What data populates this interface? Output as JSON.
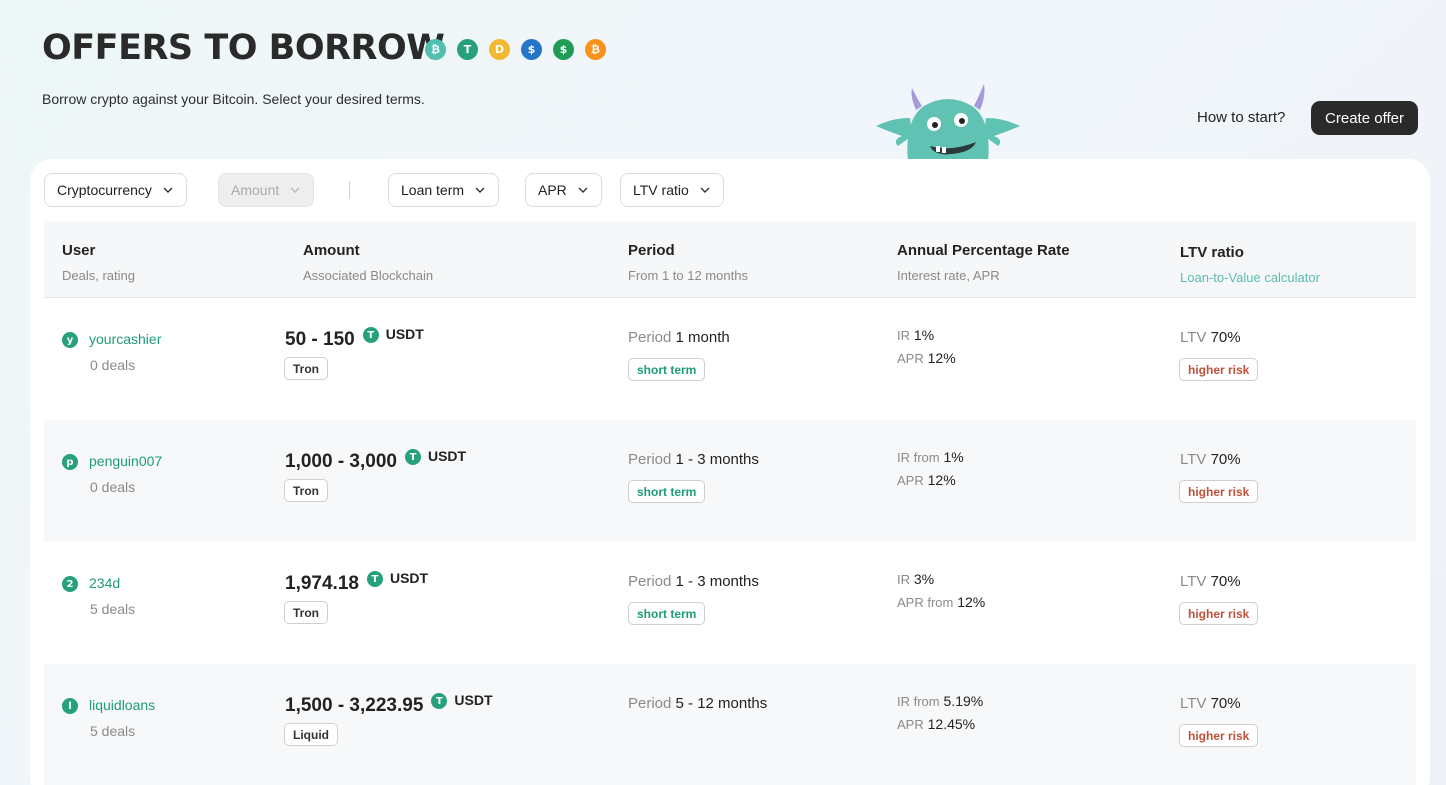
{
  "header": {
    "title": "OFFERS TO BORROW",
    "subtitle": "Borrow crypto against your Bitcoin. Select your desired terms.",
    "how_to_start": "How to start?",
    "create_offer": "Create offer",
    "coins": [
      {
        "name": "wbtc-icon",
        "color": "#4fbfb0",
        "glyph": "₿"
      },
      {
        "name": "usdt-icon",
        "color": "#26a17b",
        "glyph": "T"
      },
      {
        "name": "dai-icon",
        "color": "#f4b731",
        "glyph": "D"
      },
      {
        "name": "usdc-icon",
        "color": "#2775ca",
        "glyph": "$"
      },
      {
        "name": "dollar-icon",
        "color": "#1f9d55",
        "glyph": "$"
      },
      {
        "name": "btc-icon",
        "color": "#f7931a",
        "glyph": "₿"
      }
    ]
  },
  "filters": {
    "cryptocurrency": "Cryptocurrency",
    "amount": "Amount",
    "loan_term": "Loan term",
    "apr": "APR",
    "ltv_ratio": "LTV ratio"
  },
  "table": {
    "columns": [
      {
        "title": "User",
        "subtitle": "Deals, rating"
      },
      {
        "title": "Amount",
        "subtitle": "Associated Blockchain"
      },
      {
        "title": "Period",
        "subtitle": "From 1 to 12 months"
      },
      {
        "title": "Annual Percentage Rate",
        "subtitle": "Interest rate, APR"
      },
      {
        "title": "LTV ratio",
        "subtitle": "Loan-to-Value calculator"
      }
    ],
    "rows": [
      {
        "avatar": "y",
        "avatar_color": "#26a17b",
        "user": "yourcashier",
        "deals": "0 deals",
        "amount": "50 - 150",
        "token": "USDT",
        "chain": "Tron",
        "period_label": "Period",
        "period": "1 month",
        "term_tag": "short term",
        "ir_label": "IR",
        "ir": "1%",
        "apr_label": "APR",
        "apr": "12%",
        "ltv_label": "LTV",
        "ltv": "70%",
        "risk_tag": "higher risk"
      },
      {
        "avatar": "p",
        "avatar_color": "#26a17b",
        "user": "penguin007",
        "deals": "0 deals",
        "amount": "1,000 - 3,000",
        "token": "USDT",
        "chain": "Tron",
        "period_label": "Period",
        "period": "1 - 3 months",
        "term_tag": "short term",
        "ir_label": "IR from",
        "ir": "1%",
        "apr_label": "APR",
        "apr": "12%",
        "ltv_label": "LTV",
        "ltv": "70%",
        "risk_tag": "higher risk"
      },
      {
        "avatar": "2",
        "avatar_color": "#26a17b",
        "user": "234d",
        "deals": "5 deals",
        "amount": "1,974.18",
        "token": "USDT",
        "chain": "Tron",
        "period_label": "Period",
        "period": "1 - 3 months",
        "term_tag": "short term",
        "ir_label": "IR",
        "ir": "3%",
        "apr_label": "APR from",
        "apr": "12%",
        "ltv_label": "LTV",
        "ltv": "70%",
        "risk_tag": "higher risk"
      },
      {
        "avatar": "l",
        "avatar_color": "#26a17b",
        "user": "liquidloans",
        "deals": "5 deals",
        "amount": "1,500 - 3,223.95",
        "token": "USDT",
        "chain": "Liquid",
        "period_label": "Period",
        "period": "5 - 12 months",
        "term_tag": "",
        "ir_label": "IR from",
        "ir": "5.19%",
        "apr_label": "APR",
        "apr": "12.45%",
        "ltv_label": "LTV",
        "ltv": "70%",
        "risk_tag": "higher risk"
      }
    ]
  }
}
